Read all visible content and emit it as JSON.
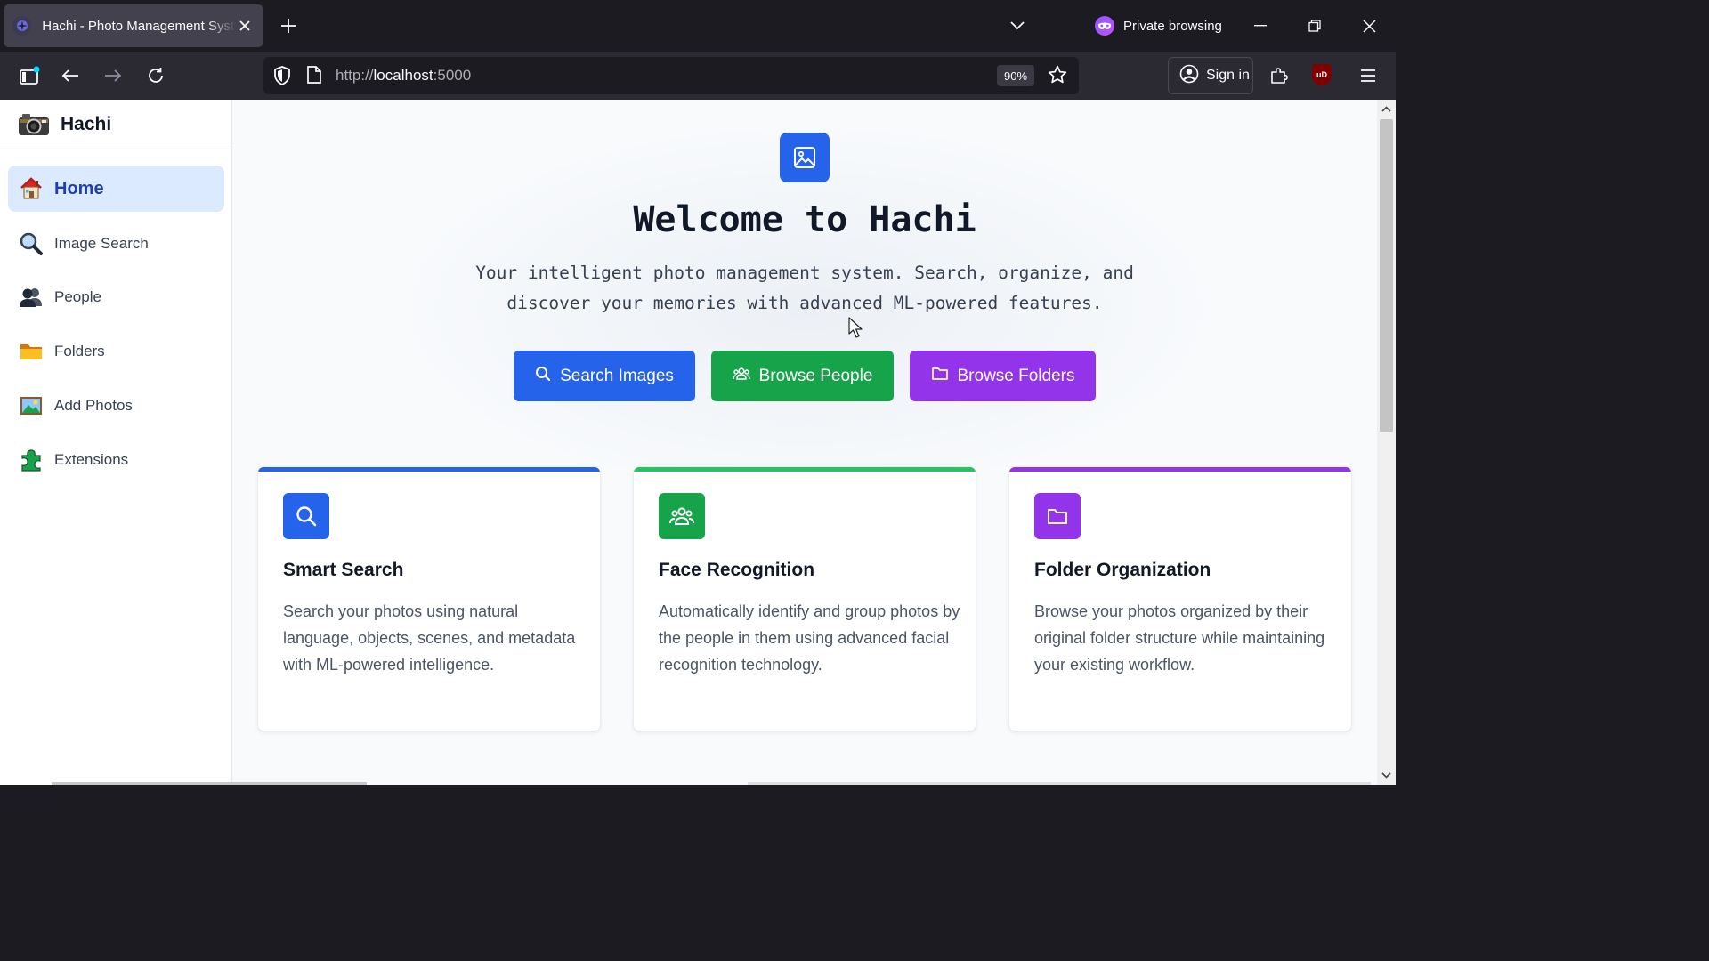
{
  "browser": {
    "tab_title": "Hachi - Photo Management System",
    "private_label": "Private browsing",
    "url_scheme": "http://",
    "url_host": "localhost",
    "url_port": ":5000",
    "zoom": "90%",
    "sign_in": "Sign in",
    "ublock_label": "uD"
  },
  "sidebar": {
    "brand": "Hachi",
    "items": [
      {
        "label": "Home",
        "icon": "house-icon",
        "active": true
      },
      {
        "label": "Image Search",
        "icon": "magnifier-icon",
        "active": false
      },
      {
        "label": "People",
        "icon": "people-icon",
        "active": false
      },
      {
        "label": "Folders",
        "icon": "folder-icon",
        "active": false
      },
      {
        "label": "Add Photos",
        "icon": "picture-icon",
        "active": false
      },
      {
        "label": "Extensions",
        "icon": "puzzle-icon",
        "active": false
      }
    ]
  },
  "hero": {
    "title": "Welcome to Hachi",
    "subtitle": "Your intelligent photo management system. Search, organize, and discover your memories with advanced ML-powered features.",
    "buttons": [
      {
        "label": "Search Images",
        "color": "#2563eb"
      },
      {
        "label": "Browse People",
        "color": "#16a34a"
      },
      {
        "label": "Browse Folders",
        "color": "#9333ea"
      }
    ]
  },
  "features": [
    {
      "title": "Smart Search",
      "description": "Search your photos using natural language, objects, scenes, and metadata with ML-powered intelligence.",
      "accent": "#2563eb"
    },
    {
      "title": "Face Recognition",
      "description": "Automatically identify and group photos by the people in them using advanced facial recognition technology.",
      "accent": "#22c55e"
    },
    {
      "title": "Folder Organization",
      "description": "Browse your photos organized by their original folder structure while maintaining your existing workflow.",
      "accent": "#9333ea"
    }
  ]
}
